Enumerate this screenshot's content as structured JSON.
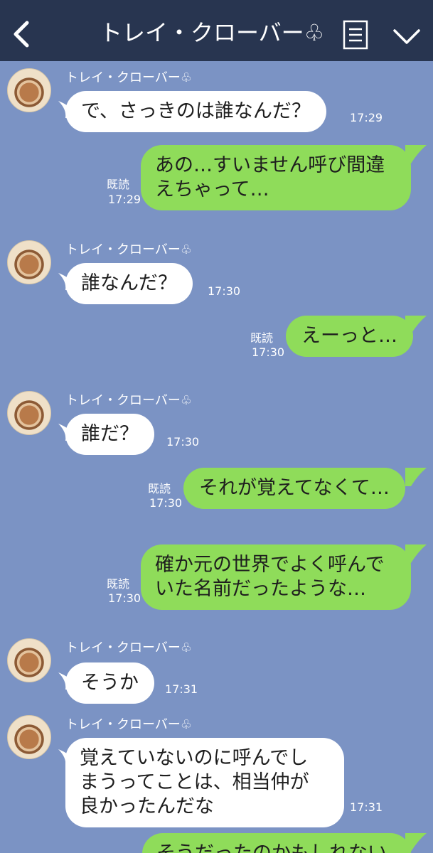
{
  "header": {
    "title": "トレイ・クローバー♧",
    "back_icon": "chevron-left-icon",
    "menu_icon": "document-menu-icon",
    "expand_icon": "chevron-down-icon",
    "background": "#283550"
  },
  "colors": {
    "chat_background": "#7b93c4",
    "incoming_bubble": "#ffffff",
    "outgoing_bubble": "#8fdc5a"
  },
  "messages": [
    {
      "direction": "in",
      "sender": "トレイ・クローバー♧",
      "text": "で、さっきのは誰なんだ？",
      "time": "17:29"
    },
    {
      "direction": "out",
      "text": "あの…すいません呼び間違\nえちゃって…",
      "read": "既読",
      "time": "17:29"
    },
    {
      "direction": "in",
      "sender": "トレイ・クローバー♧",
      "text": "誰なんだ？",
      "time": "17:30"
    },
    {
      "direction": "out",
      "text": "えーっと…",
      "read": "既読",
      "time": "17:30"
    },
    {
      "direction": "in",
      "sender": "トレイ・クローバー♧",
      "text": "誰だ？",
      "time": "17:30"
    },
    {
      "direction": "out",
      "text": "それが覚えてなくて…",
      "read": "既読",
      "time": "17:30"
    },
    {
      "direction": "out",
      "text": "確か元の世界でよく呼んで\nいた名前だったような…",
      "read": "既読",
      "time": "17:30"
    },
    {
      "direction": "in",
      "sender": "トレイ・クローバー♧",
      "text": "そうか",
      "time": "17:31"
    },
    {
      "direction": "in",
      "sender": "トレイ・クローバー♧",
      "text": "覚えていないのに呼んでし\nまうってことは、相当仲が\n良かったんだな",
      "time": "17:31"
    },
    {
      "direction": "out",
      "text": "そうだったのかもしれない"
    }
  ]
}
